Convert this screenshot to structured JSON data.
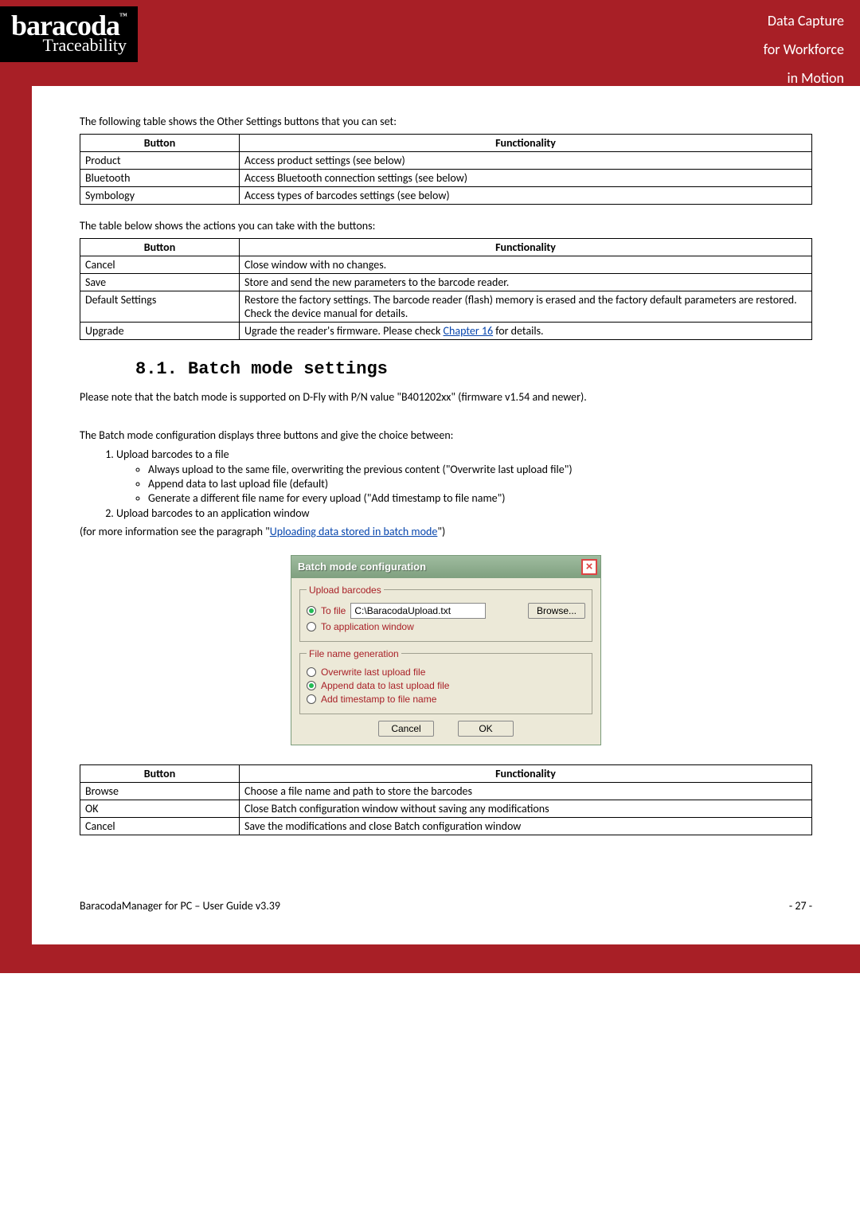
{
  "header": {
    "logo_line1": "baracoda",
    "logo_tm": "™",
    "logo_line2": "Traceability",
    "tagline_line1": "Data Capture",
    "tagline_line2": "for Workforce",
    "tagline_line3": "in Motion"
  },
  "intro1": "The following table shows the Other Settings buttons that you can set:",
  "table1": {
    "h1": "Button",
    "h2": "Functionality",
    "rows": [
      {
        "c1": "Product",
        "c2": "Access product settings (see below)"
      },
      {
        "c1": "Bluetooth",
        "c2": "Access Bluetooth connection settings (see below)"
      },
      {
        "c1": "Symbology",
        "c2": "Access types of barcodes settings (see below)"
      }
    ]
  },
  "intro2": "The table below shows the actions you can take with the buttons:",
  "table2": {
    "h1": "Button",
    "h2": "Functionality",
    "rows": [
      {
        "c1": "Cancel",
        "c2": "Close window with no changes."
      },
      {
        "c1": "Save",
        "c2": "Store and send the new parameters to the barcode reader."
      },
      {
        "c1": "Default Settings",
        "c2": "Restore the factory settings. The barcode reader (flash) memory is erased and the factory default parameters are restored. Check the device manual for details."
      },
      {
        "c1": "Upgrade",
        "c2_pre": "Ugrade the reader's firmware. Please check ",
        "c2_link": "Chapter 16",
        "c2_post": " for details."
      }
    ]
  },
  "section_heading": "8.1.  Batch mode settings",
  "p_note": "Please note that the batch mode is supported on D-Fly with P/N  value \"B401202xx\" (firmware v1.54 and newer).",
  "p_config_intro": "The Batch mode configuration displays three buttons and give the choice between:",
  "list": {
    "item1": "Upload barcodes to a file",
    "sub1": "Always upload to the same file, overwriting the previous content (\"Overwrite last upload file\")",
    "sub2": "Append data to last upload file (default)",
    "sub3": "Generate a different file name for every upload (\"Add timestamp to file name\")",
    "item2": "Upload barcodes to an application window"
  },
  "p_moreinfo_pre": "(for more information see the paragraph \"",
  "p_moreinfo_link": "Uploading data stored in batch mode",
  "p_moreinfo_post": "\")",
  "dialog": {
    "title": "Batch mode configuration",
    "close": "×",
    "group1_legend": "Upload barcodes",
    "radio_tofile": "To file",
    "file_path": "C:\\BaracodaUpload.txt",
    "browse": "Browse...",
    "radio_toapp": "To application window",
    "group2_legend": "File name generation",
    "radio_overwrite": "Overwrite last upload file",
    "radio_append": "Append data to last upload file",
    "radio_timestamp": "Add timestamp to file name",
    "btn_cancel": "Cancel",
    "btn_ok": "OK"
  },
  "table3": {
    "h1": "Button",
    "h2": "Functionality",
    "rows": [
      {
        "c1": "Browse",
        "c2": "Choose a file name and path to store the barcodes"
      },
      {
        "c1": "OK",
        "c2": "Close Batch configuration window without saving any modifications"
      },
      {
        "c1": "Cancel",
        "c2": "Save the modifications and close Batch configuration window"
      }
    ]
  },
  "footer": {
    "left": "BaracodaManager for PC – User Guide v3.39",
    "right": "- 27 -"
  }
}
